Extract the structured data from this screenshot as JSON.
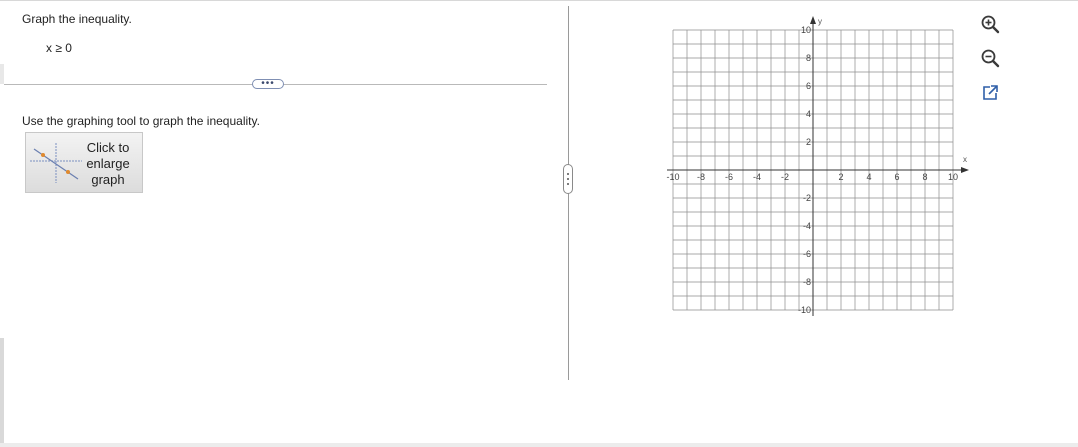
{
  "question": {
    "prompt": "Graph the inequality.",
    "equation": "x ≥ 0",
    "more_button": "•••",
    "instruction": "Use the graphing tool to graph the inequality.",
    "enlarge_button": [
      "Click to",
      "enlarge",
      "graph"
    ]
  },
  "graph": {
    "x_axis_label": "x",
    "y_axis_label": "y",
    "x_ticks": [
      "-10",
      "-8",
      "-6",
      "-4",
      "-2",
      "2",
      "4",
      "6",
      "8",
      "10"
    ],
    "y_ticks": [
      "10",
      "8",
      "6",
      "4",
      "2",
      "-2",
      "-4",
      "-6",
      "-8",
      "-10"
    ],
    "xlim": [
      -10,
      10
    ],
    "ylim": [
      -10,
      10
    ],
    "grid_step": 1,
    "grid": true
  },
  "toolbar": {
    "zoom_in_icon": "zoom-in-icon",
    "zoom_out_icon": "zoom-out-icon",
    "popout_icon": "external-link-icon"
  },
  "colors": {
    "grid": "#8c8c8c",
    "axis": "#333333",
    "icon": "#3a3a3a",
    "popout": "#2f5fa8"
  }
}
